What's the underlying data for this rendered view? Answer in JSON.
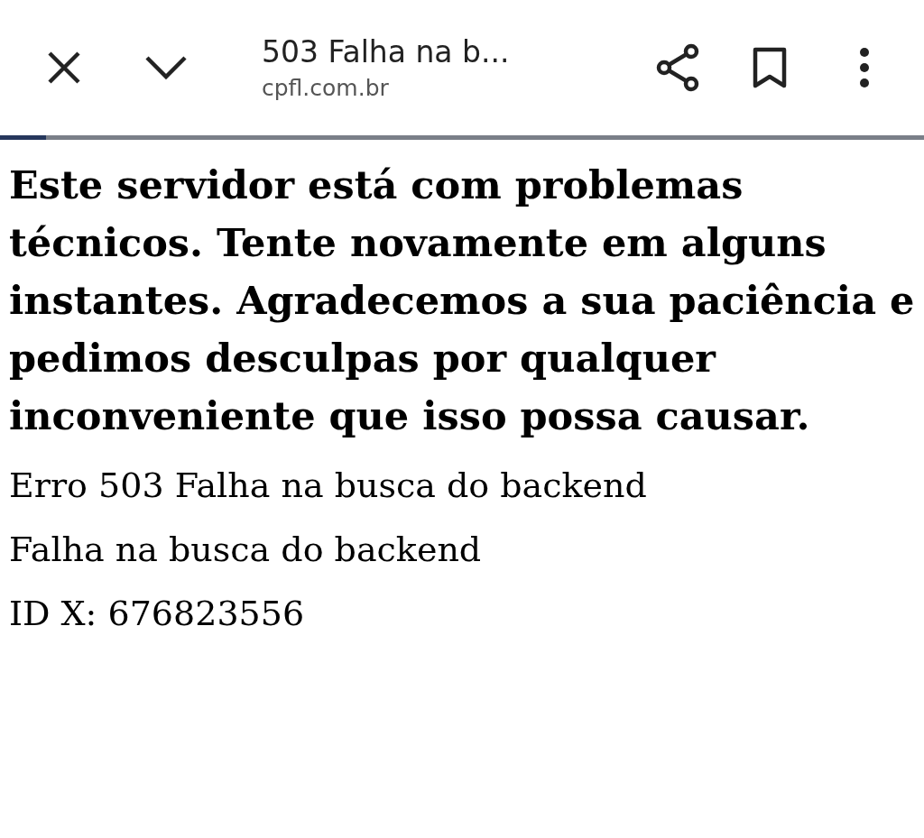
{
  "browser_bar": {
    "title": "503 Falha na b...",
    "url": "cpfl.com.br",
    "progress": {
      "level": 0.05
    }
  },
  "page": {
    "heading": "Este servidor está com problemas técnicos. Tente novamente em alguns instantes. Agradecemos a sua paciência e pedimos desculpas por qualquer inconveniente que isso possa causar.",
    "paragraphs": [
      "Erro 503 Falha na busca do backend",
      "Falha na busca do backend",
      "ID X: 676823556"
    ]
  }
}
